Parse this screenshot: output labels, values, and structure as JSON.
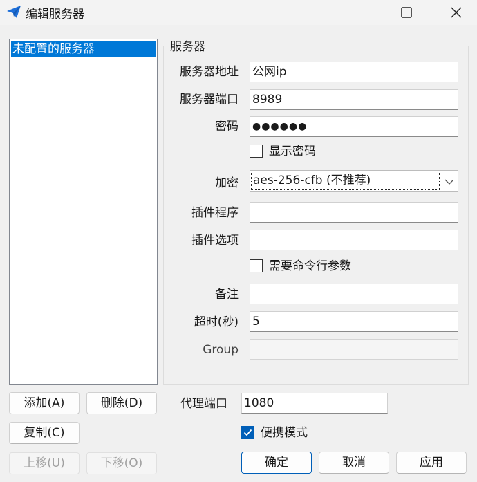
{
  "window": {
    "title": "编辑服务器"
  },
  "server_list": {
    "items": [
      "未配置的服务器"
    ]
  },
  "group": {
    "title": "服务器"
  },
  "form": {
    "server_address_label": "服务器地址",
    "server_address_value": "公网ip",
    "server_port_label": "服务器端口",
    "server_port_value": "8989",
    "password_label": "密码",
    "password_value": "●●●●●●",
    "show_password_label": "显示密码",
    "encryption_label": "加密",
    "encryption_value": "aes-256-cfb (不推荐)",
    "plugin_program_label": "插件程序",
    "plugin_program_value": "",
    "plugin_options_label": "插件选项",
    "plugin_options_value": "",
    "need_cli_args_label": "需要命令行参数",
    "remarks_label": "备注",
    "remarks_value": "",
    "timeout_label": "超时(秒)",
    "timeout_value": "5",
    "group_label": "Group",
    "group_value": ""
  },
  "proxy": {
    "port_label": "代理端口",
    "port_value": "1080",
    "portable_mode_label": "便携模式"
  },
  "buttons": {
    "add": "添加(A)",
    "delete": "删除(D)",
    "copy": "复制(C)",
    "move_up": "上移(U)",
    "move_down": "下移(O)",
    "ok": "确定",
    "cancel": "取消",
    "apply": "应用"
  },
  "colors": {
    "accent": "#0078d7",
    "checkbox_checked": "#005fb8"
  }
}
